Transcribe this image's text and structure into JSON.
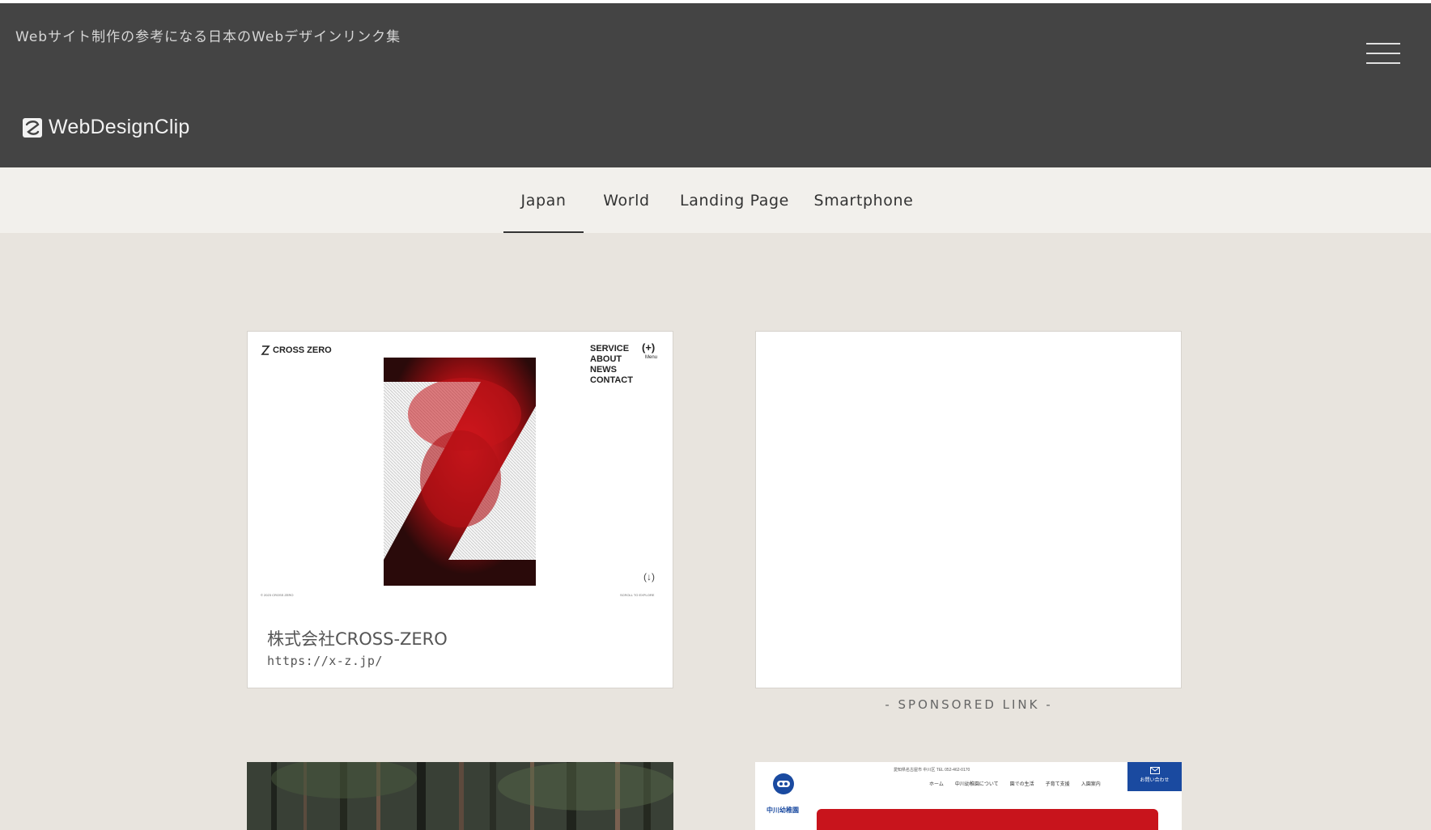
{
  "header": {
    "tagline": "Webサイト制作の参考になる日本のWebデザインリンク集",
    "logo_text": "WebDesignClip",
    "logo_icon": "logo-mark-icon",
    "menu_icon": "hamburger-menu-icon"
  },
  "nav": {
    "tabs": [
      {
        "label": "Japan",
        "active": true
      },
      {
        "label": "World",
        "active": false
      },
      {
        "label": "Landing Page",
        "active": false
      },
      {
        "label": "Smartphone",
        "active": false
      }
    ]
  },
  "cards": [
    {
      "title": "株式会社CROSS-ZERO",
      "url": "https://x-z.jp/",
      "thumb": {
        "brand": "CROSS ZERO",
        "menu": [
          "SERVICE",
          "ABOUT",
          "NEWS",
          "CONTACT"
        ],
        "plus": "(+)",
        "menu_label": "Menu",
        "scroll_arrow": "(↓)",
        "copyright": "© 2023 CROSS ZERO",
        "scroll_label": "SCROLL TO EXPLORE"
      }
    }
  ],
  "sponsored": {
    "label": "- SPONSORED LINK -"
  },
  "third_card": {
    "thumb": {
      "topline": "愛知県名古屋市 中川区 TEL 052-462-0170",
      "menu": [
        "ホーム",
        "中川幼稚園について",
        "園での生活",
        "子育て支援",
        "入園案内"
      ],
      "contact_button": "お問い合わせ",
      "school_name": "中川幼稚園"
    }
  },
  "colors": {
    "header_bg": "#444444",
    "nav_bg": "#f2f0ec",
    "page_bg": "#e8e4de",
    "accent_red": "#c8141c",
    "accent_blue": "#1a4aa0"
  }
}
